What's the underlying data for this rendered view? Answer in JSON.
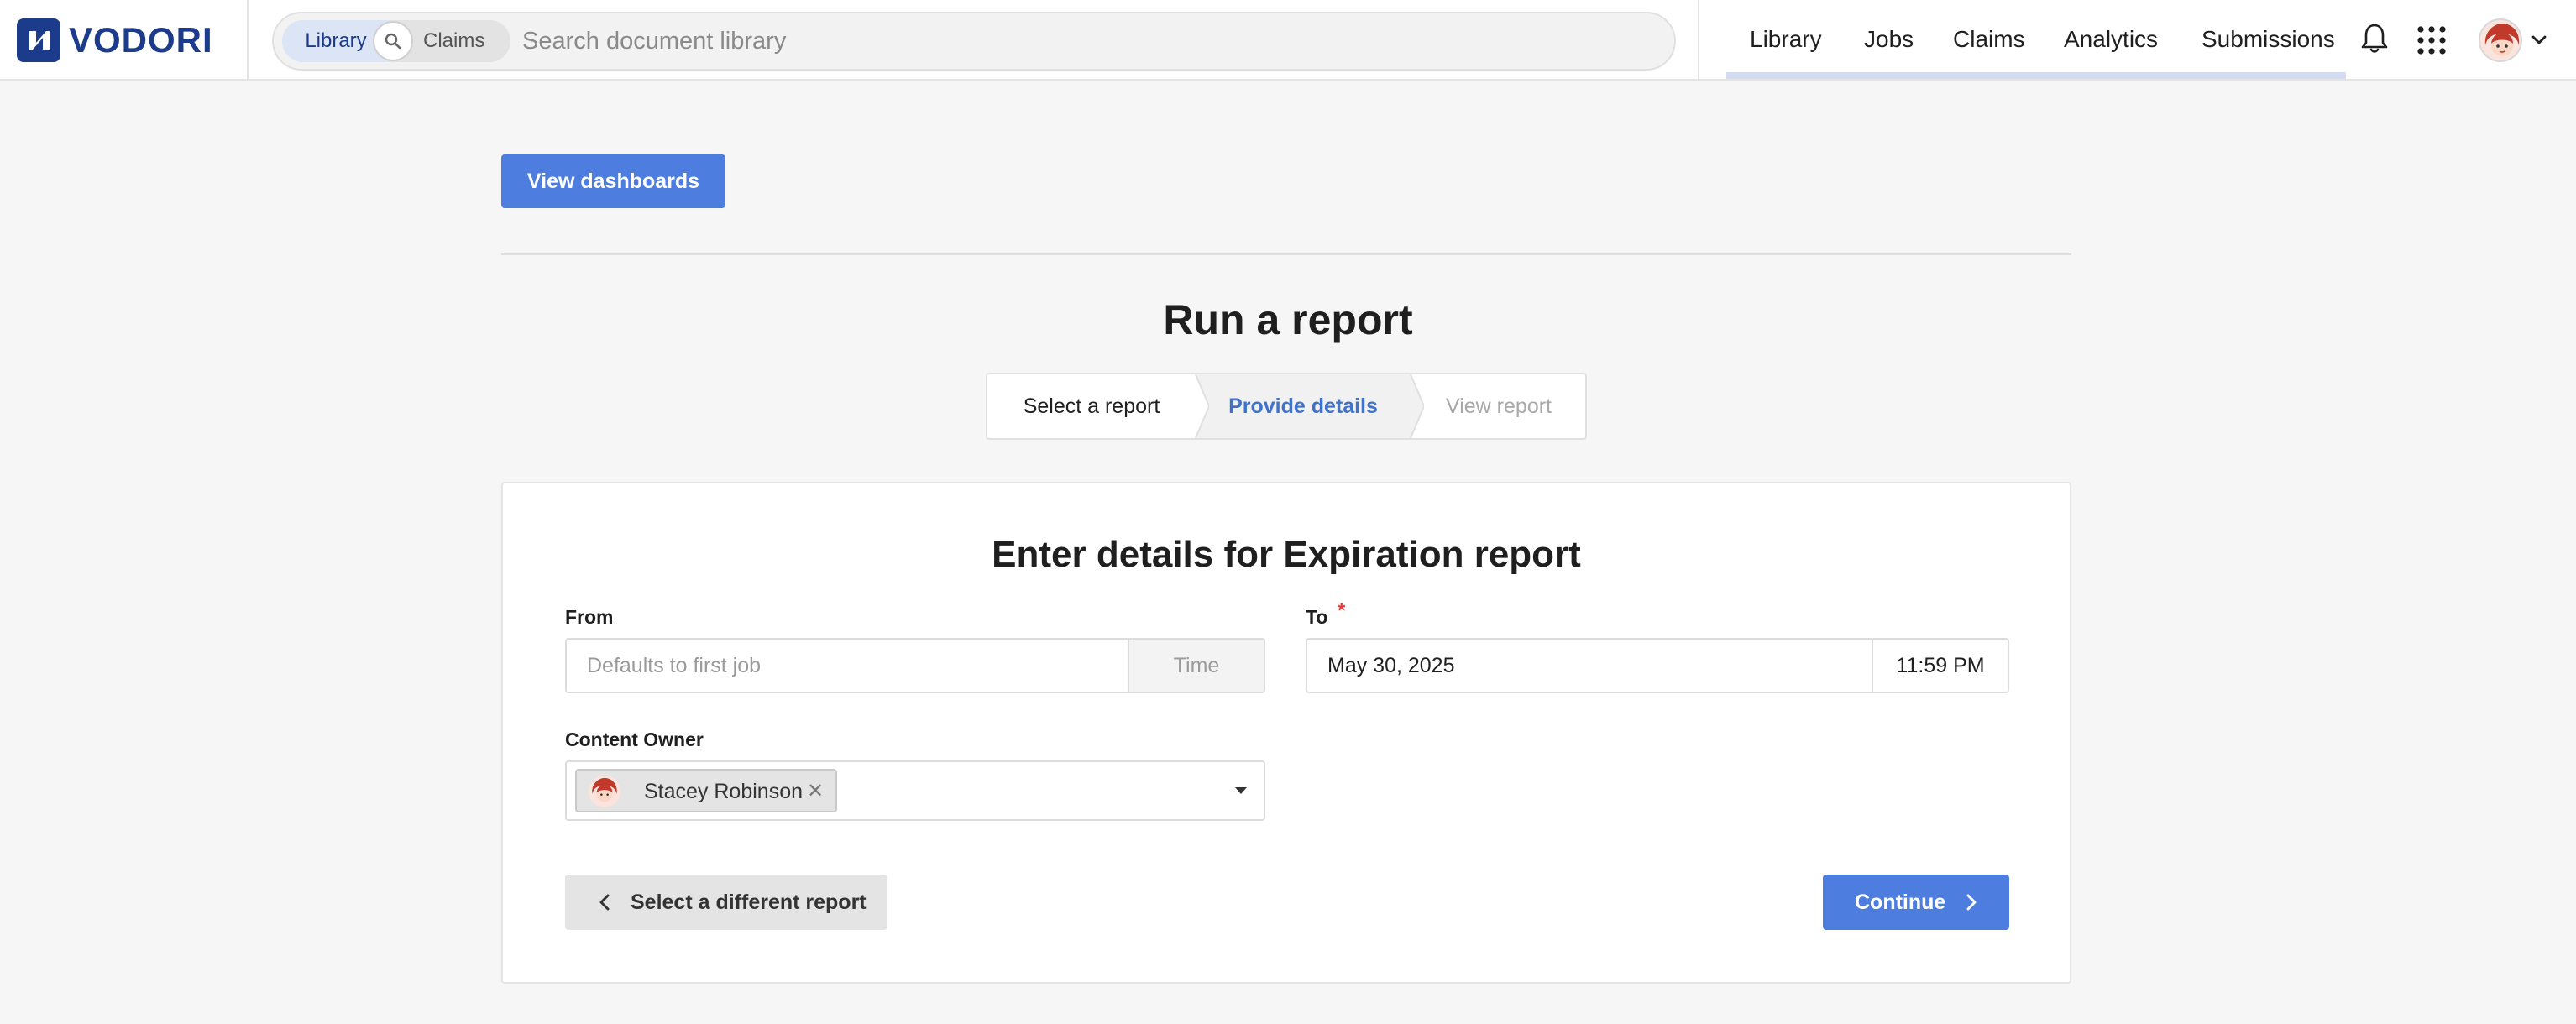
{
  "brand": {
    "name": "VODORI",
    "color": "#1d3b8b"
  },
  "search": {
    "scope_library": "Library",
    "scope_claims": "Claims",
    "placeholder": "Search document library",
    "icon": "search-icon"
  },
  "nav": {
    "items": [
      {
        "label": "Library"
      },
      {
        "label": "Jobs"
      },
      {
        "label": "Claims"
      },
      {
        "label": "Analytics"
      },
      {
        "label": "Submissions"
      }
    ],
    "icons": [
      "bell-icon",
      "apps-grid-icon",
      "user-avatar",
      "chevron-down-icon"
    ]
  },
  "page": {
    "view_dashboards": "View dashboards",
    "title": "Run a report",
    "steps": [
      {
        "label": "Select a report",
        "state": "complete"
      },
      {
        "label": "Provide details",
        "state": "active"
      },
      {
        "label": "View report",
        "state": "upcoming"
      }
    ]
  },
  "form": {
    "title": "Enter details for Expiration report",
    "from": {
      "label": "From",
      "date_placeholder": "Defaults to first job",
      "time_placeholder": "Time"
    },
    "to": {
      "label": "To",
      "required_mark": "*",
      "date_value": "May 30, 2025",
      "time_value": "11:59 PM"
    },
    "owner": {
      "label": "Content Owner",
      "selected": "Stacey Robinson",
      "remove_glyph": "✕"
    },
    "back_button": "Select a different report",
    "continue_button": "Continue"
  },
  "colors": {
    "accent": "#4e7de0",
    "active_step": "#3f72c9",
    "required": "#e53935"
  }
}
